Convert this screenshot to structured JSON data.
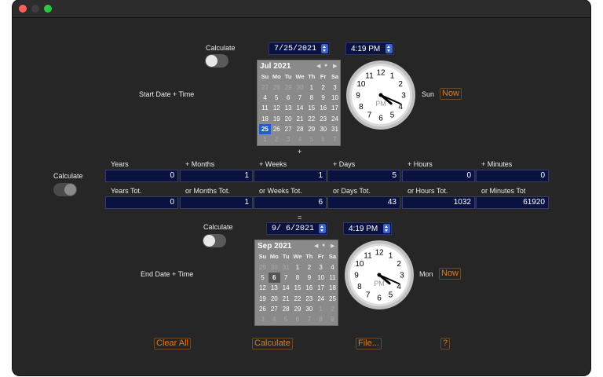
{
  "window": {
    "traffic_lights": {
      "close": "#fe5f57",
      "minimize": "#3a3a3a",
      "zoom": "#28c840"
    }
  },
  "start": {
    "calc_label": "Calculate",
    "date": "7/25/2021",
    "time": "4:19 PM",
    "label": "Start Date + Time",
    "weekday": "Sun",
    "now_label": "Now",
    "calendar": {
      "month": "Jul 2021",
      "dows": [
        "Su",
        "Mo",
        "Tu",
        "We",
        "Th",
        "Fr",
        "Sa"
      ],
      "days": [
        "27",
        "28",
        "29",
        "30",
        "1",
        "2",
        "3",
        "4",
        "5",
        "6",
        "7",
        "8",
        "9",
        "10",
        "11",
        "12",
        "13",
        "14",
        "15",
        "16",
        "17",
        "18",
        "19",
        "20",
        "21",
        "22",
        "23",
        "24",
        "25",
        "26",
        "27",
        "28",
        "29",
        "30",
        "31",
        "1",
        "2",
        "3",
        "4",
        "5",
        "6",
        "7"
      ]
    },
    "clock": {
      "pm_label": "PM",
      "hour": 16,
      "minute": 19
    }
  },
  "plus_sign": "+",
  "equals_sign": "=",
  "middle": {
    "calc_label": "Calculate",
    "headers": [
      "Years",
      "+ Months",
      "+ Weeks",
      "+ Days",
      "+ Hours",
      "+ Minutes"
    ],
    "values": [
      "0",
      "1",
      "1",
      "5",
      "0",
      "0"
    ],
    "tot_headers": [
      "Years Tot.",
      "or Months Tot.",
      "or Weeks Tot.",
      "or Days Tot.",
      "or Hours Tot.",
      "or Minutes Tot"
    ],
    "tot_values": [
      "0",
      "1",
      "6",
      "43",
      "1032",
      "61920"
    ]
  },
  "end": {
    "calc_label": "Calculate",
    "date": "9/ 6/2021",
    "time": "4:19 PM",
    "label": "End Date + Time",
    "weekday": "Mon",
    "now_label": "Now",
    "calendar": {
      "month": "Sep 2021",
      "dows": [
        "Su",
        "Mo",
        "Tu",
        "We",
        "Th",
        "Fr",
        "Sa"
      ],
      "days": [
        "29",
        "30",
        "31",
        "1",
        "2",
        "3",
        "4",
        "5",
        "6",
        "7",
        "8",
        "9",
        "10",
        "11",
        "12",
        "13",
        "14",
        "15",
        "16",
        "17",
        "18",
        "19",
        "20",
        "21",
        "22",
        "23",
        "24",
        "25",
        "26",
        "27",
        "28",
        "29",
        "30",
        "1",
        "2",
        "3",
        "4",
        "5",
        "6",
        "7",
        "8",
        "9"
      ]
    },
    "clock": {
      "pm_label": "PM",
      "hour": 16,
      "minute": 19
    }
  },
  "bottom": {
    "clear_all": "Clear All",
    "calculate": "Calculate",
    "file": "File...",
    "help": "?"
  },
  "colors": {
    "accent": "#e07a20",
    "field_bg": "#0a1240",
    "selected": "#1f5fd0"
  }
}
